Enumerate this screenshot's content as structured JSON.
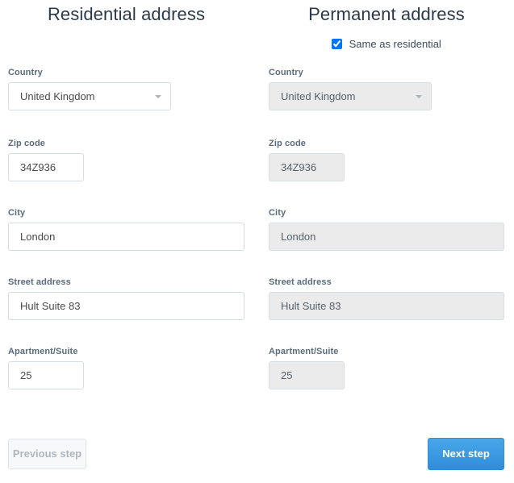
{
  "columns": {
    "residential": {
      "title": "Residential address",
      "fields": {
        "country": {
          "label": "Country",
          "value": "United Kingdom"
        },
        "zip": {
          "label": "Zip code",
          "value": "34Z936"
        },
        "city": {
          "label": "City",
          "value": "London"
        },
        "street": {
          "label": "Street address",
          "value": "Hult Suite 83"
        },
        "apartment": {
          "label": "Apartment/Suite",
          "value": "25"
        }
      }
    },
    "permanent": {
      "title": "Permanent address",
      "same_as_residential_label": "Same as residential",
      "same_as_residential_checked": true,
      "fields": {
        "country": {
          "label": "Country",
          "value": "United Kingdom"
        },
        "zip": {
          "label": "Zip code",
          "value": "34Z936"
        },
        "city": {
          "label": "City",
          "value": "London"
        },
        "street": {
          "label": "Street address",
          "value": "Hult Suite 83"
        },
        "apartment": {
          "label": "Apartment/Suite",
          "value": "25"
        }
      }
    }
  },
  "footer": {
    "previous_label": "Previous step",
    "next_label": "Next step"
  },
  "colors": {
    "heading": "#2b3a4a",
    "label": "#5a6b7b",
    "border": "#d5dce2",
    "disabled_bg": "#ebebeb",
    "primary": "#2f8ddb",
    "secondary_text": "#aeb6bf"
  }
}
